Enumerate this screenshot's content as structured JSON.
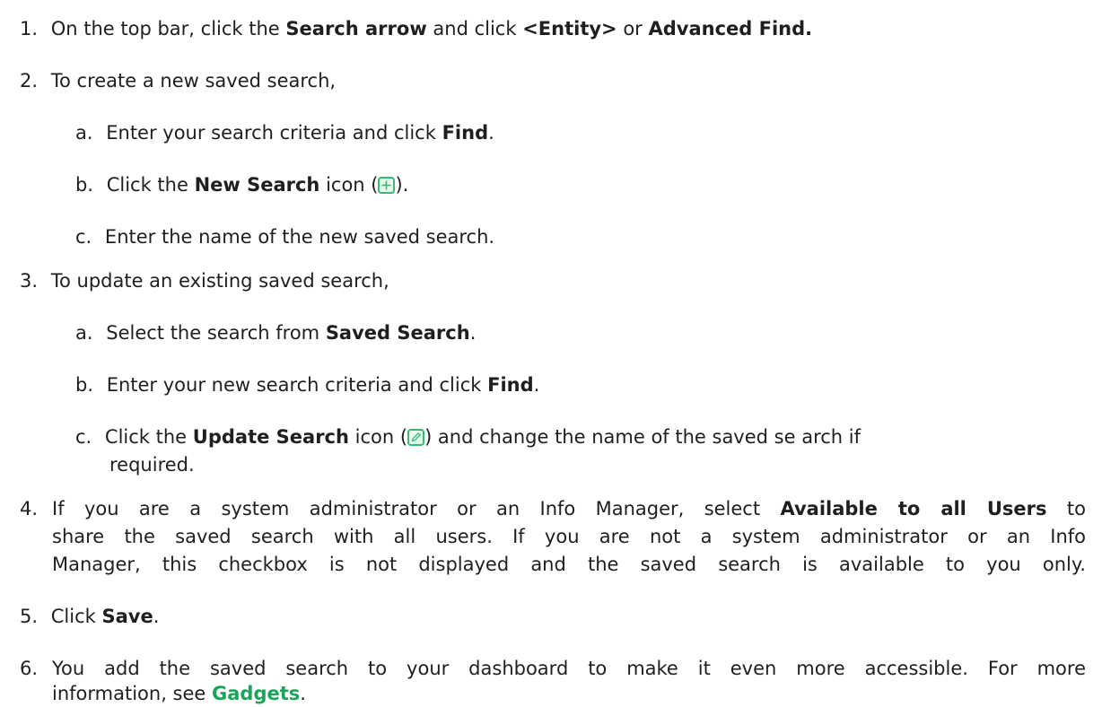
{
  "steps": {
    "s1": {
      "num": "1.",
      "t1": "On the top bar, click the ",
      "b1": "Search arrow",
      "t2": " and click ",
      "b2": "<Entity>",
      "t3": " or ",
      "b3": "Advanced Find."
    },
    "s2": {
      "num": "2.",
      "text": "To create a new saved search,",
      "a": {
        "letter": "a.",
        "t1": "Enter your search criteria and click ",
        "b1": "Find",
        "t2": "."
      },
      "b": {
        "letter": "b.",
        "t1": "Click the ",
        "b1": "New Search",
        "t2": " icon (",
        "t3": ")."
      },
      "c": {
        "letter": "c.",
        "text": "Enter the name of the new saved search."
      }
    },
    "s3": {
      "num": "3.",
      "text": "To update an existing saved search,",
      "a": {
        "letter": "a.",
        "t1": "Select the search from ",
        "b1": "Saved Search",
        "t2": "."
      },
      "b": {
        "letter": "b.",
        "t1": "Enter your new search criteria and click ",
        "b1": "Find",
        "t2": "."
      },
      "c": {
        "letter": "c.",
        "t1": "Click the ",
        "b1": "Update Search",
        "t2": " icon (",
        "t3": ") and change the name of the saved se arch if",
        "t4": "required."
      }
    },
    "s4": {
      "num": "4.",
      "l1a": "If you are a system administrator or an Info Manager, select ",
      "l1b": "Available to all Users",
      "l1c": " to",
      "l2": "share the saved search with all users. If you are not a system administrator or an Info",
      "l3": "Manager, this checkbox is not displayed and the saved search is available to you only."
    },
    "s5": {
      "num": "5.",
      "t1": "Click ",
      "b1": "Save",
      "t2": "."
    },
    "s6": {
      "num": "6.",
      "l1": "You add the saved search to your dashboard to make it even more accessible. For more",
      "l2a": "information, see ",
      "l2link": "Gadgets",
      "l2b": "."
    }
  },
  "icons": {
    "new_search": "plus-icon",
    "update_search": "pencil-icon"
  },
  "colors": {
    "link": "#1aa55a",
    "icon_border": "#2fbf6f",
    "icon_fill": "#e9f8ef",
    "text": "#1f1f1f"
  }
}
